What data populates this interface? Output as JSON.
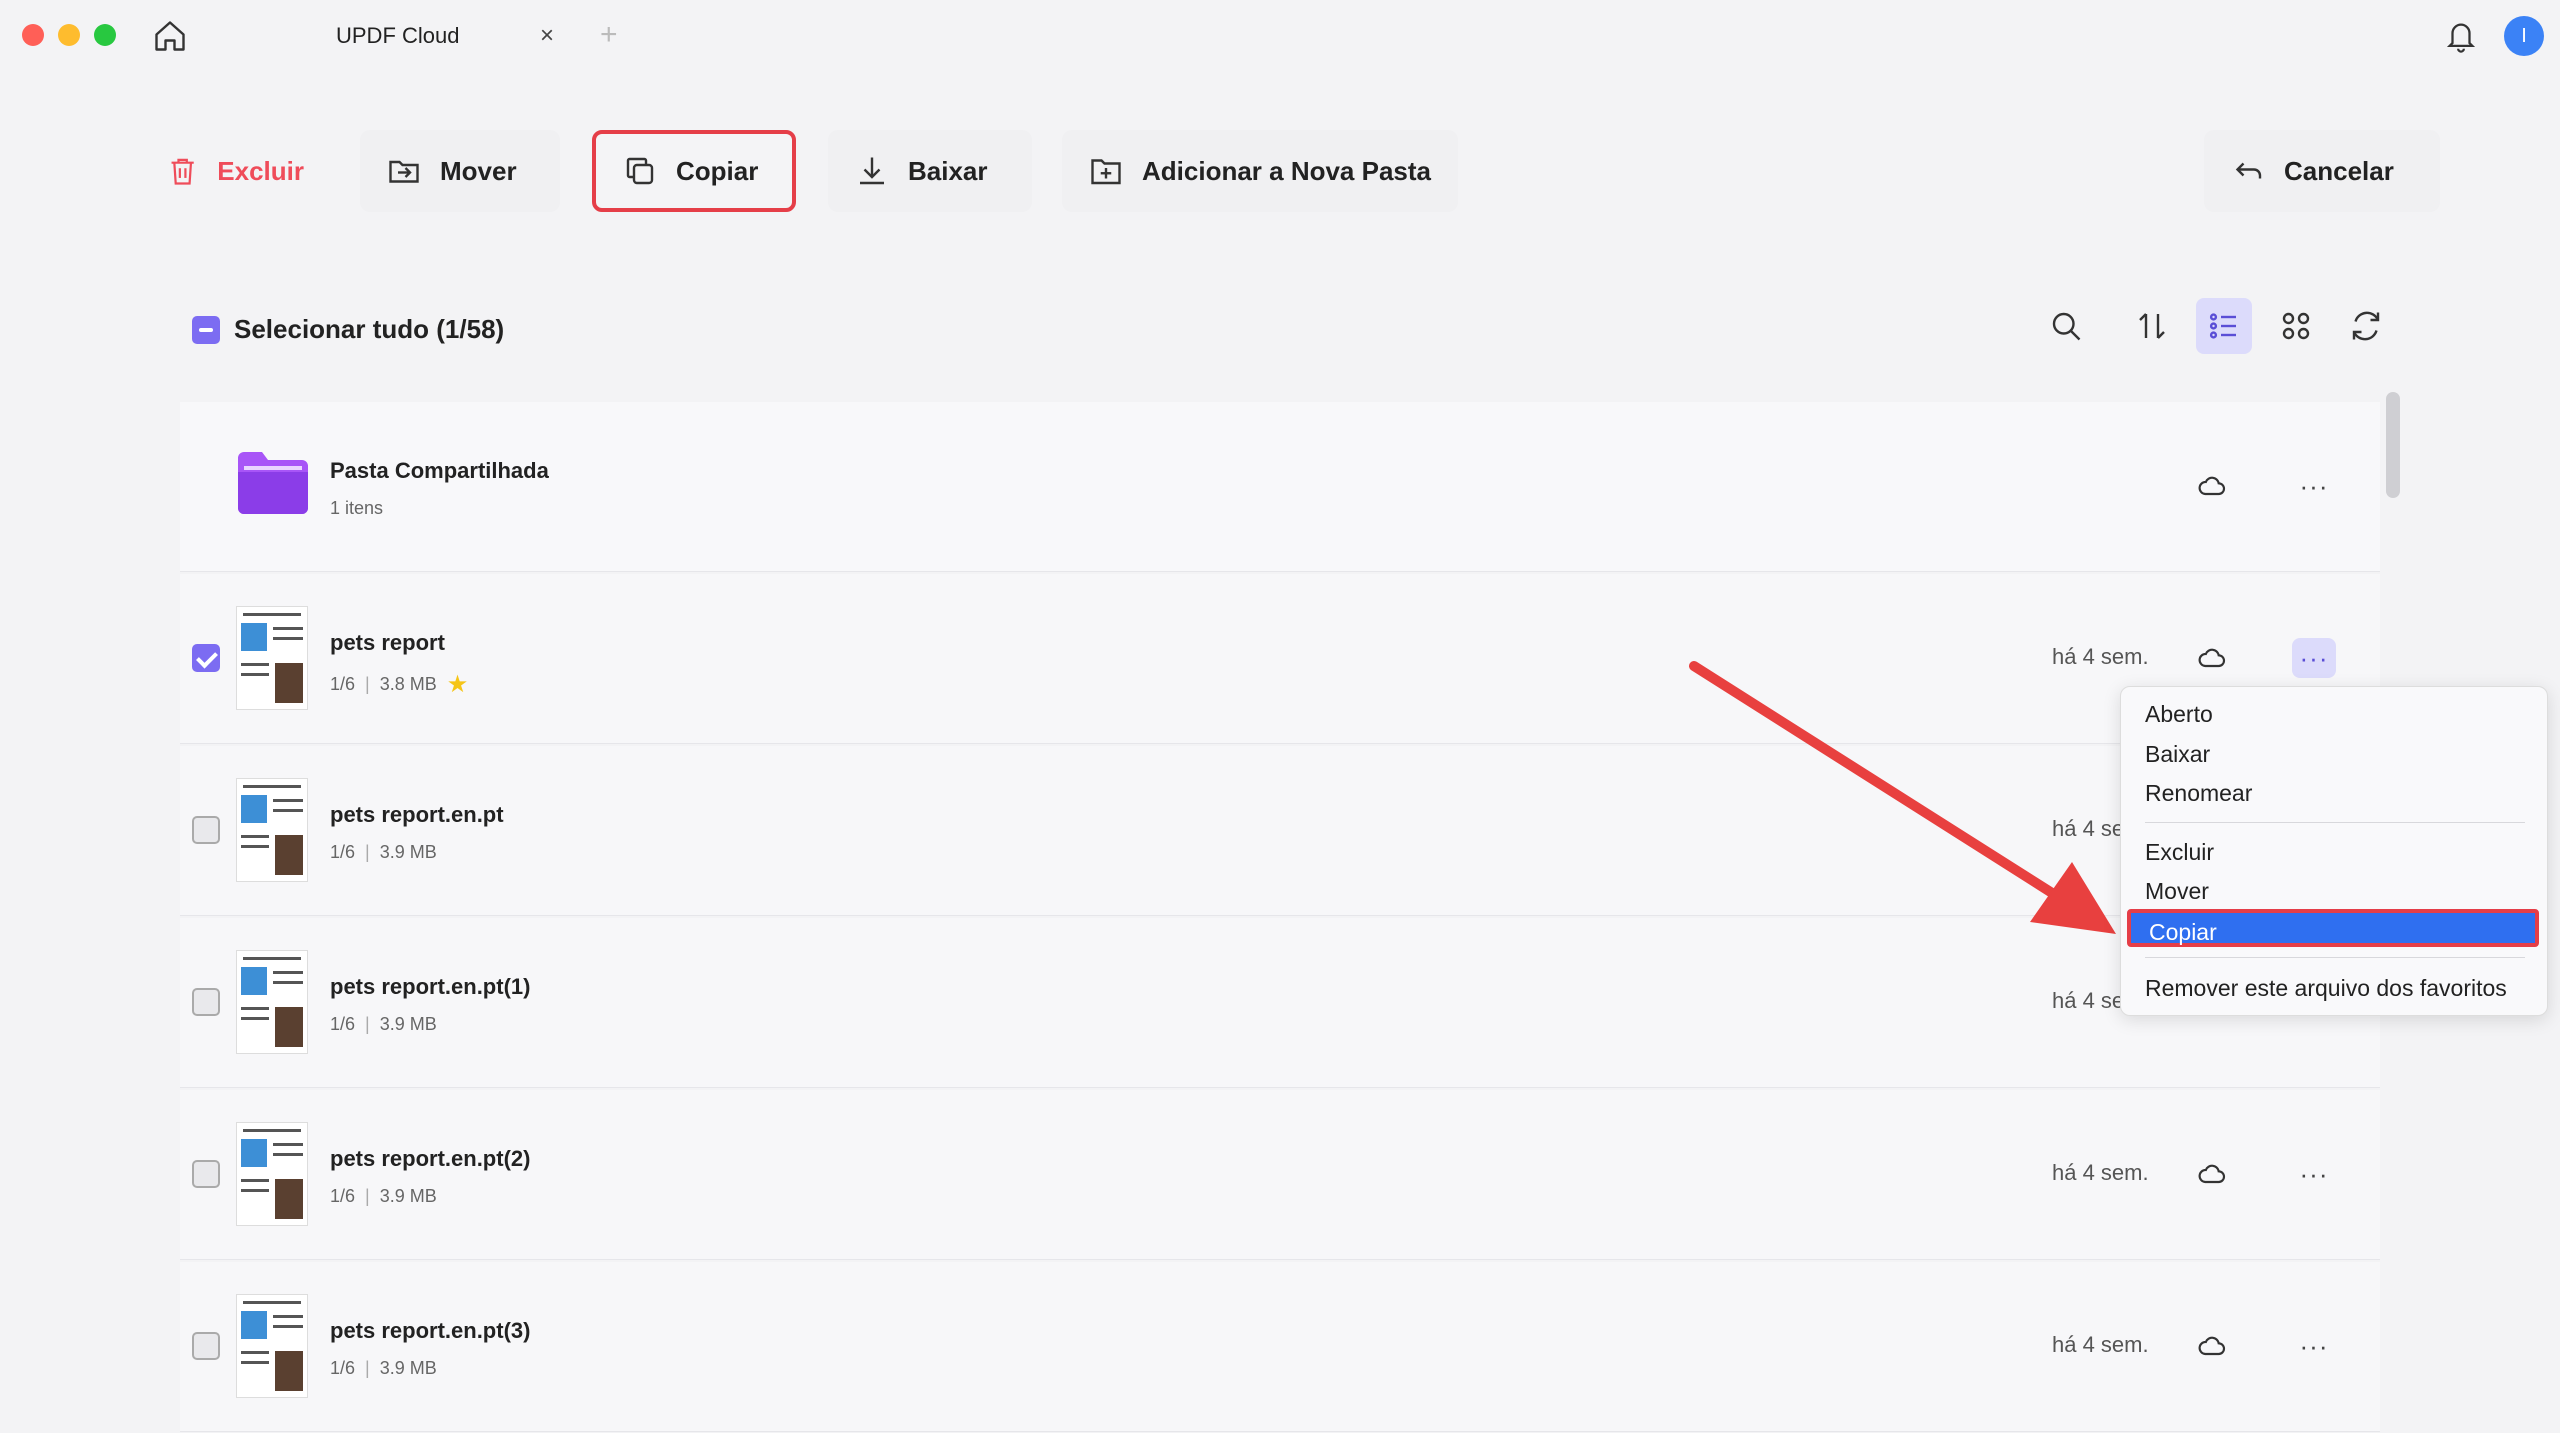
{
  "window": {
    "tab_title": "UPDF Cloud",
    "tab_close": "×",
    "tab_add": "+",
    "avatar_initial": "I"
  },
  "toolbar": {
    "excluir": "Excluir",
    "mover": "Mover",
    "copiar": "Copiar",
    "baixar": "Baixar",
    "nova_pasta": "Adicionar a Nova Pasta",
    "cancelar": "Cancelar"
  },
  "list_header": {
    "select_all": "Selecionar tudo (1/58)"
  },
  "folder": {
    "name": "Pasta Compartilhada",
    "meta": "1 itens"
  },
  "files": [
    {
      "name": "pets report",
      "pages": "1/6",
      "size": "3.8 MB",
      "date": "há 4 sem.",
      "checked": true,
      "favorite": true
    },
    {
      "name": "pets report.en.pt",
      "pages": "1/6",
      "size": "3.9 MB",
      "date": "há 4 se",
      "checked": false,
      "favorite": false
    },
    {
      "name": "pets report.en.pt(1)",
      "pages": "1/6",
      "size": "3.9 MB",
      "date": "há 4 se",
      "checked": false,
      "favorite": false
    },
    {
      "name": "pets report.en.pt(2)",
      "pages": "1/6",
      "size": "3.9 MB",
      "date": "há 4 sem.",
      "checked": false,
      "favorite": false
    },
    {
      "name": "pets report.en.pt(3)",
      "pages": "1/6",
      "size": "3.9 MB",
      "date": "há 4 sem.",
      "checked": false,
      "favorite": false
    }
  ],
  "meta_separator": "|",
  "more_glyph": "···",
  "star_glyph": "★",
  "context_menu": {
    "aberto": "Aberto",
    "baixar": "Baixar",
    "renomear": "Renomear",
    "excluir": "Excluir",
    "mover": "Mover",
    "copiar": "Copiar",
    "remover_favoritos": "Remover este arquivo dos favoritos"
  },
  "colors": {
    "accent": "#7c6cf2",
    "danger": "#ef4c5a",
    "highlight_border": "#e53e48",
    "menu_selected": "#2f6ff0"
  }
}
